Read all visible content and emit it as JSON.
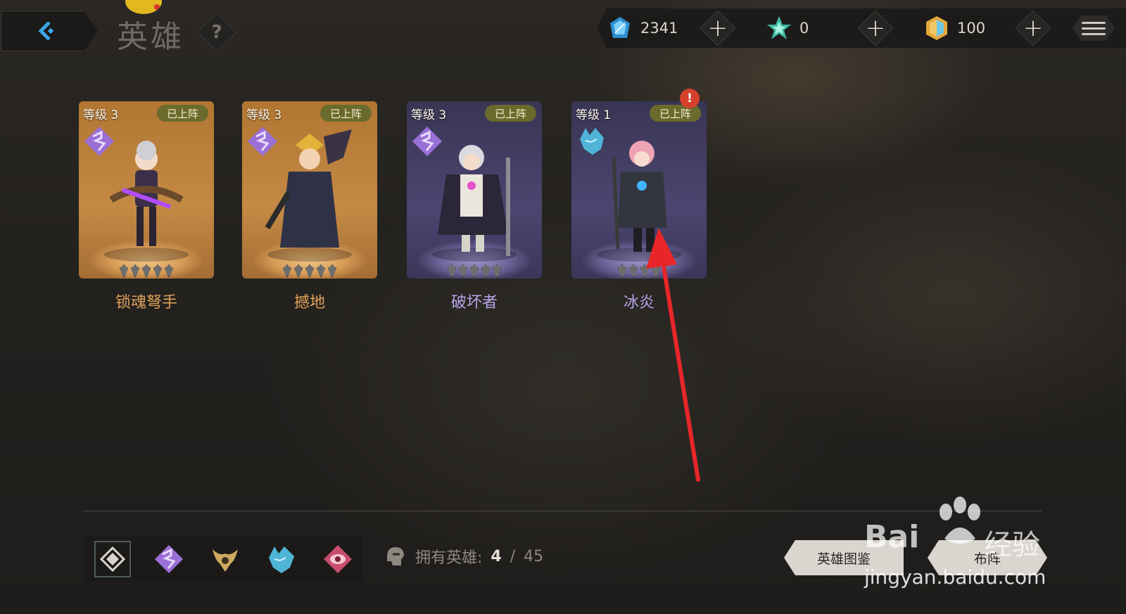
{
  "header": {
    "title": "英雄",
    "help_label": "?"
  },
  "currencies": [
    {
      "name": "crystal",
      "icon": "blue-crystal-icon",
      "value": "2341"
    },
    {
      "name": "energy",
      "icon": "green-energy-icon",
      "value": "0"
    },
    {
      "name": "token",
      "icon": "gold-token-icon",
      "value": "100"
    }
  ],
  "plus_label": "+",
  "heroes": [
    {
      "level": "等级 3",
      "status": "已上阵",
      "name": "锁魂弩手",
      "theme": "gold",
      "class_icon": "purple-class-emblem-icon",
      "stars": 5
    },
    {
      "level": "等级 3",
      "status": "已上阵",
      "name": "撼地",
      "theme": "gold",
      "class_icon": "purple-class-emblem-icon",
      "stars": 5
    },
    {
      "level": "等级 3",
      "status": "已上阵",
      "name": "破坏者",
      "theme": "purple",
      "class_icon": "purple-class-emblem-icon",
      "stars": 5
    },
    {
      "level": "等级 1",
      "status": "已上阵",
      "name": "冰炎",
      "theme": "purple",
      "class_icon": "cyan-wolf-emblem-icon",
      "stars": 4,
      "notification": "!"
    }
  ],
  "filters": [
    "all-classes-icon",
    "purple-class-emblem-icon",
    "gold-horned-emblem-icon",
    "cyan-wolf-emblem-icon",
    "pink-eye-emblem-icon"
  ],
  "owned": {
    "label": "拥有英雄:",
    "count": "4",
    "separator": "/",
    "total": "45"
  },
  "buttons": {
    "hero_dex": "英雄图鉴",
    "formation": "布阵"
  },
  "watermark": {
    "brand": "Bai",
    "brand_cn": "经验",
    "url": "jingyan.baidu.com"
  },
  "colors": {
    "gold_name": "#e0a15a",
    "purple_name": "#b4a6ea",
    "deployed_badge": "#6a6a2c",
    "alert": "#d6412d",
    "annotation_arrow": "#e8262a"
  }
}
